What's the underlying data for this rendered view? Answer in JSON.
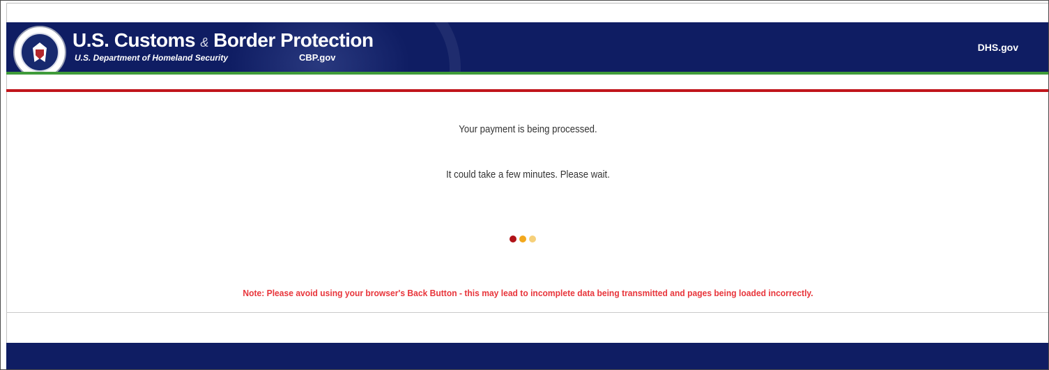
{
  "header": {
    "agency_name_part1": "U.S. Customs",
    "agency_name_amp": "&",
    "agency_name_part2": "Border Protection",
    "department": "U.S. Department of Homeland Security",
    "site_link": "CBP.gov",
    "dhs_link": "DHS.gov",
    "seal_icon": "dhs-seal-icon"
  },
  "main": {
    "message_primary": "Your payment is being processed.",
    "message_secondary": "It could take a few minutes. Please wait.",
    "loader_dots": [
      "#b01218",
      "#f2a81d",
      "#f6d07a"
    ],
    "note": "Note: Please avoid using your browser's Back Button - this may lead to incomplete data being transmitted and pages being loaded incorrectly."
  },
  "colors": {
    "header_bg": "#0f1d63",
    "green_stripe": "#3f9b3a",
    "red_stripe": "#c0151b",
    "note_text": "#e8353b"
  }
}
